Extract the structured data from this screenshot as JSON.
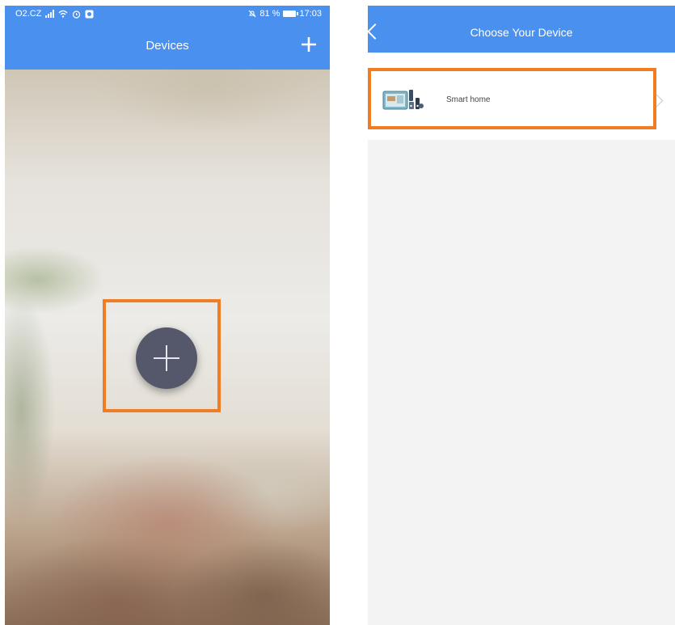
{
  "left_screen": {
    "status": {
      "carrier": "O2.CZ",
      "battery_text": "81 %",
      "time": "17:03"
    },
    "header": {
      "title": "Devices",
      "add_icon": "plus-icon"
    },
    "fab": {
      "icon": "plus-icon"
    },
    "highlight_color": "#f07c23"
  },
  "right_screen": {
    "header": {
      "title": "Choose Your Device",
      "back_icon": "chevron-left-icon"
    },
    "devices": [
      {
        "label": "Smart home",
        "icon": "smart-home-kit-icon",
        "chevron": "chevron-right-icon"
      }
    ],
    "highlight_color": "#f07c23"
  },
  "colors": {
    "brand_blue": "#4a90ee",
    "fab": "#55576a",
    "highlight": "#f07c23"
  }
}
